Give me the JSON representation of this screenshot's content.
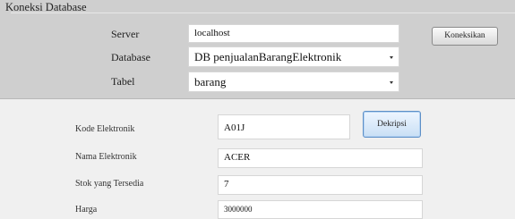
{
  "connection": {
    "group_title": "Koneksi Database",
    "server_label": "Server",
    "server_value": "localhost",
    "database_label": "Database",
    "database_value": "DB penjualanBarangElektronik",
    "table_label": "Tabel",
    "table_value": "barang",
    "connect_button": "Koneksikan"
  },
  "form": {
    "kode_label": "Kode Elektronik",
    "kode_value": "A01J",
    "check_button": "Dekripsi",
    "nama_label": "Nama Elektronik",
    "nama_value": "ACER",
    "stok_label": "Stok yang Tersedia",
    "stok_value": "7",
    "harga_label": "Harga",
    "harga_value": "3000000"
  }
}
